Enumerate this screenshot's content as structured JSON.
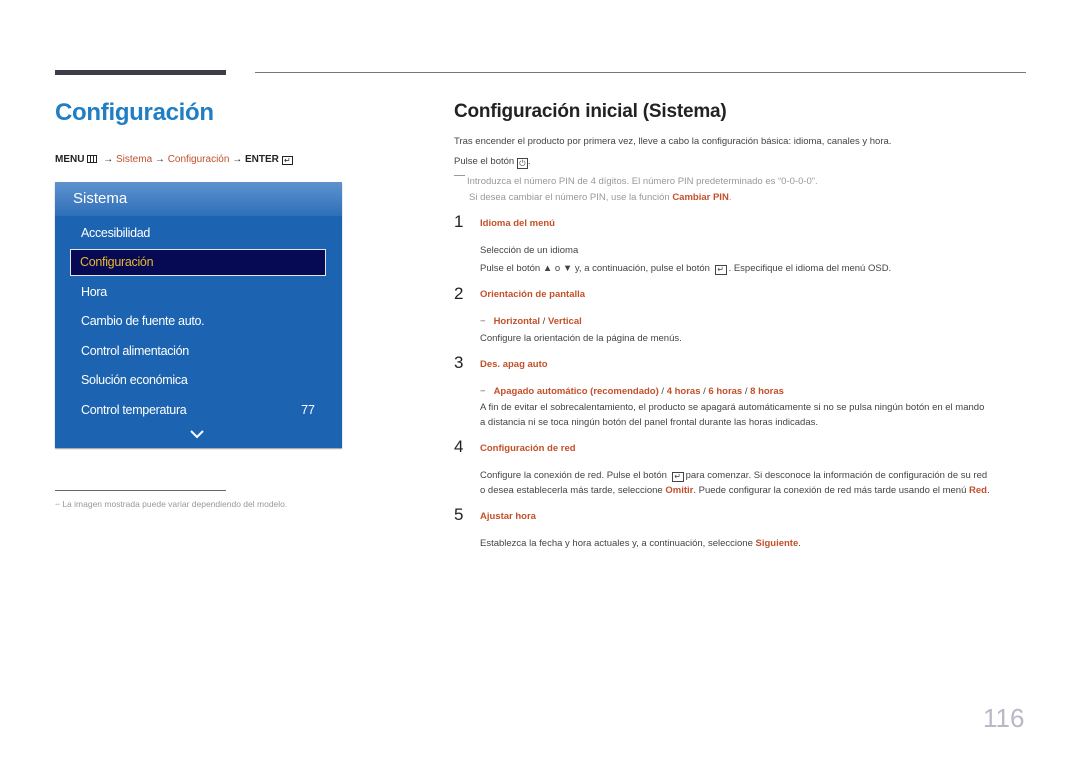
{
  "left": {
    "title": "Configuración",
    "menu_path": {
      "menu": "MENU",
      "arrow": "→",
      "sistema": "Sistema",
      "configuracion": "Configuración",
      "enter": "ENTER"
    },
    "osd": {
      "header": "Sistema",
      "items": [
        {
          "label": "Accesibilidad"
        },
        {
          "label": "Configuración",
          "selected": true
        },
        {
          "label": "Hora"
        },
        {
          "label": "Cambio de fuente auto."
        },
        {
          "label": "Control alimentación"
        },
        {
          "label": "Solución económica"
        },
        {
          "label": "Control temperatura",
          "value": "77"
        }
      ]
    },
    "note": "−  La imagen mostrada puede variar dependiendo del modelo."
  },
  "right": {
    "title": "Configuración inicial (Sistema)",
    "intro": "Tras encender el producto por primera vez, lleve a cabo la configuración básica: idioma, canales y hora.",
    "press_power_pre": "Pulse el botón",
    "press_power_post": ".",
    "pin_note_1": "Introduzca el número PIN de 4 dígitos. El número PIN predeterminado es “0-0-0-0”.",
    "pin_note_2_pre": "Si desea cambiar el número PIN, use la función",
    "pin_note_2_link": "Cambiar PIN",
    "pin_note_2_post": ".",
    "steps": [
      {
        "num": "1",
        "title": "Idioma del menú",
        "line1": "Selección de un idioma",
        "line2_pre": "Pulse el botón",
        "line2_mid1": "o",
        "line2_mid2": "y, a continuación, pulse el botón",
        "line2_post": ". Especifique el idioma del menú OSD."
      },
      {
        "num": "2",
        "title": "Orientación de pantalla",
        "options": [
          "Horizontal",
          "Vertical"
        ],
        "desc": "Configure la orientación de la página de menús."
      },
      {
        "num": "3",
        "title": "Des. apag auto",
        "options": [
          "Apagado automático (recomendado)",
          "4 horas",
          "6 horas",
          "8 horas"
        ],
        "desc1": "A fin de evitar el sobrecalentamiento, el producto se apagará automáticamente si no se pulsa ningún botón en el mando",
        "desc2": "a distancia ni se toca ningún botón del panel frontal durante las horas indicadas."
      },
      {
        "num": "4",
        "title": "Configuración de red",
        "desc1_pre": "Configure la conexión de red. Pulse el botón",
        "desc1_post": "para comenzar. Si desconoce la información de configuración de su red",
        "desc2_pre": "o desea establecerla más tarde, seleccione",
        "desc2_link1": "Omitir",
        "desc2_mid": ". Puede configurar la conexión de red más tarde usando el menú",
        "desc2_link2": "Red",
        "desc2_post": "."
      },
      {
        "num": "5",
        "title": "Ajustar hora",
        "desc_pre": "Establezca la fecha y hora actuales y, a continuación, seleccione",
        "desc_link": "Siguiente",
        "desc_post": "."
      }
    ]
  },
  "page_number": "116"
}
